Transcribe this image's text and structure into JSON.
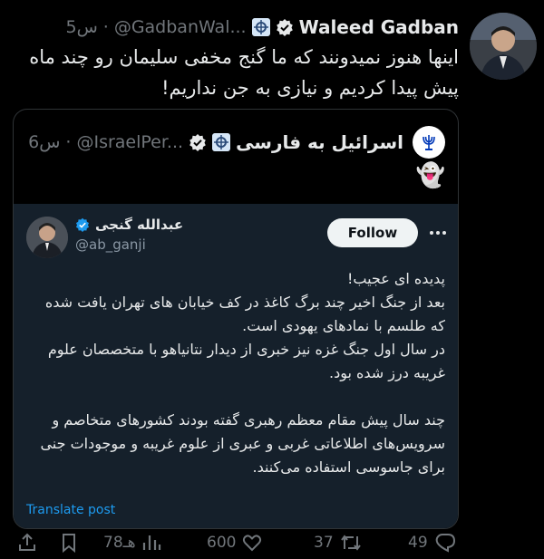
{
  "tweet": {
    "author_name": "Waleed Gadban",
    "author_handle": "@GadbanWal...",
    "time": "5س",
    "separator": "·",
    "text": "اینها هنوز نمیدونند که ما گنج مخفی سلیمان رو چند ماه پیش پیدا کردیم و نیازی به جن نداریم!"
  },
  "quote": {
    "author_name": "اسرائیل به فارسی",
    "author_handle": "@IsraelPer...",
    "time": "6س",
    "separator": "·",
    "emoji": "👻"
  },
  "inner_tweet": {
    "author_name": "عبدالله گنجی",
    "author_handle": "@ab_ganji",
    "follow_label": "Follow",
    "text": "پدیده ای عجیب!\nبعد از جنگ اخیر چند برگ کاغذ در کف خیابان های تهران یافت شده که طلسم با نمادهای یهودی است.\nدر سال اول جنگ غزه نیز خبری از دیدار نتانیاهو با متخصصان علوم غریبه درز شده بود.\n\nچند سال پیش مقام معظم رهبری گفته بودند کشورهای متخاصم و سرویس‌های اطلاعاتی غربی و عبری از علوم غریبه و موجودات جنی برای جاسوسی استفاده می‌کنند.",
    "translate_label": "Translate post"
  },
  "actions": {
    "replies": "49",
    "reposts": "37",
    "likes": "600",
    "views": "78هـ"
  },
  "icons": {
    "verified": "verified-badge-icon",
    "org_badge": "organization-badge-icon",
    "reply": "reply-icon",
    "repost": "repost-icon",
    "like": "heart-icon",
    "views": "views-icon",
    "bookmark": "bookmark-icon",
    "share": "share-icon"
  },
  "colors": {
    "background": "#000000",
    "text": "#e7e9ea",
    "muted": "#71767b",
    "verified": "#1d9bf0",
    "inner_bg": "#15202b"
  }
}
